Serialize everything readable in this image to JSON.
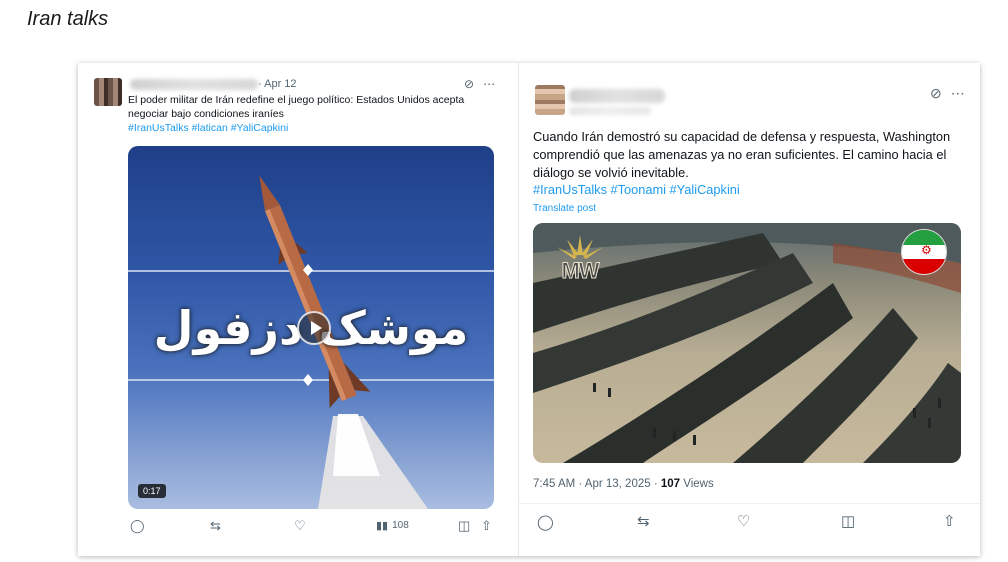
{
  "page": {
    "heading": "Iran talks"
  },
  "left_post": {
    "date": "· Apr 12",
    "text": "El poder militar de Irán redefine el juego político: Estados Unidos acepta negociar bajo condiciones iraníes",
    "hashtags": "#IranUsTalks #latican #YaliCapkini",
    "video": {
      "overlay_text": "موشک دزفول",
      "duration": "0:17"
    },
    "actions": {
      "reply_icon": "reply-icon",
      "repost_icon": "repost-icon",
      "like_icon": "heart-icon",
      "views_icon": "views-icon",
      "views_count": "108",
      "bookmark_icon": "bookmark-icon",
      "share_icon": "share-icon"
    }
  },
  "right_post": {
    "text": "Cuando Irán demostró su capacidad de defensa y respuesta, Washington comprendió que las amenazas ya no eran suficientes. El camino hacia el diálogo se volvió inevitable.",
    "hashtags": "#IranUsTalks #Toonami #YaliCapkini",
    "translate_label": "Translate post",
    "image": {
      "logo_text": "MW"
    },
    "timestamp": "7:45 AM · Apr 13, 2025 · ",
    "views_count": "107",
    "views_label": " Views"
  },
  "colors": {
    "link": "#1d9bf0",
    "muted": "#536471",
    "flag_green": "#239f40",
    "flag_white": "#ffffff",
    "flag_red": "#da0000"
  }
}
